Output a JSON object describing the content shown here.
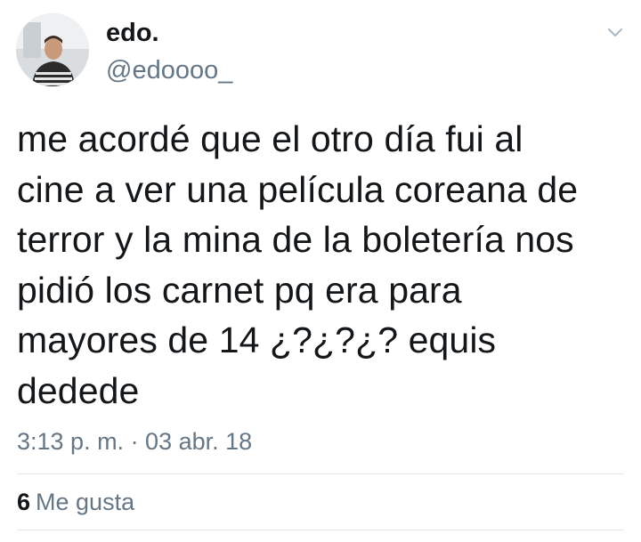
{
  "author": {
    "display_name": "edo.",
    "handle": "@edoooo_"
  },
  "tweet": {
    "text": "me acordé que el otro día fui al\ncine a ver una película coreana de\nterror y la mina de la boletería nos\npidió los carnet pq era para\nmayores de 14 ¿?¿?¿? equis\ndedede",
    "timestamp": "3:13 p. m. · 03 abr. 18"
  },
  "stats": {
    "likes_count": "6",
    "likes_label": "Me gusta"
  },
  "icons": {
    "menu": "chevron-down-icon"
  },
  "colors": {
    "text_primary": "#14171a",
    "text_secondary": "#657786",
    "divider": "#e1e8ed"
  }
}
